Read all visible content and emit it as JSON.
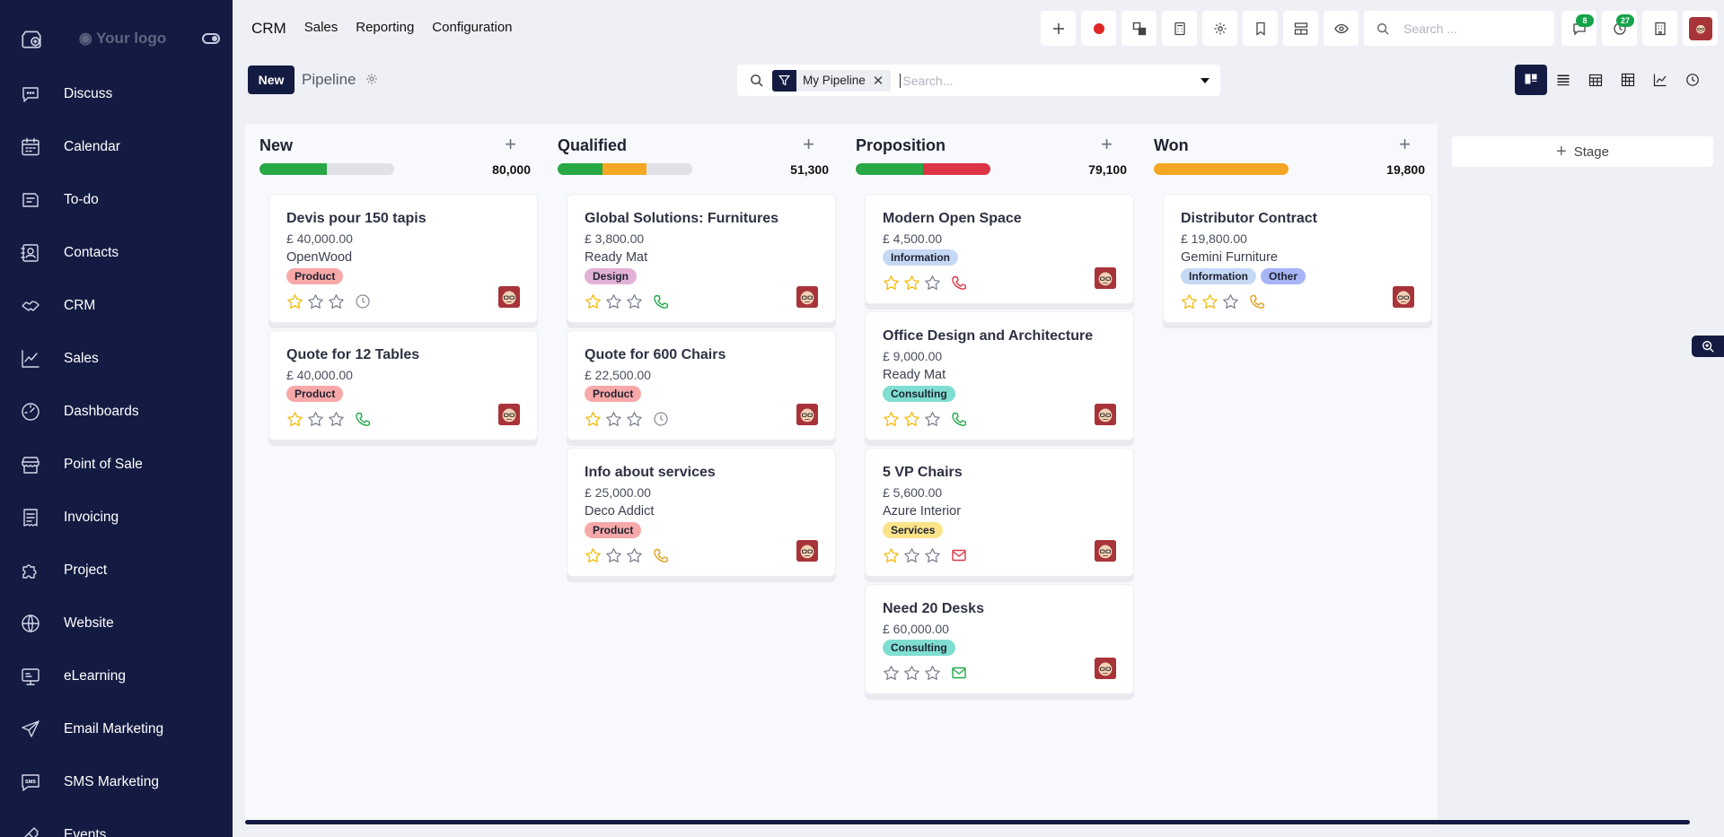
{
  "sidebar": {
    "logo_text": "Your logo",
    "items": [
      {
        "label": "Discuss",
        "icon": "chat-icon"
      },
      {
        "label": "Calendar",
        "icon": "calendar-icon"
      },
      {
        "label": "To-do",
        "icon": "todo-icon"
      },
      {
        "label": "Contacts",
        "icon": "contacts-icon"
      },
      {
        "label": "CRM",
        "icon": "handshake-icon"
      },
      {
        "label": "Sales",
        "icon": "sales-chart-icon"
      },
      {
        "label": "Dashboards",
        "icon": "gauge-icon"
      },
      {
        "label": "Point of Sale",
        "icon": "store-icon"
      },
      {
        "label": "Invoicing",
        "icon": "invoice-icon"
      },
      {
        "label": "Project",
        "icon": "puzzle-icon"
      },
      {
        "label": "Website",
        "icon": "globe-icon"
      },
      {
        "label": "eLearning",
        "icon": "elearning-icon"
      },
      {
        "label": "Email Marketing",
        "icon": "paper-plane-icon"
      },
      {
        "label": "SMS Marketing",
        "icon": "sms-icon"
      },
      {
        "label": "Events",
        "icon": "ticket-icon"
      }
    ]
  },
  "topbar": {
    "brand": "CRM",
    "menu": [
      "Sales",
      "Reporting",
      "Configuration"
    ],
    "search_placeholder": "Search ...",
    "messages_count": "8",
    "activities_count": "27"
  },
  "control": {
    "new_label": "New",
    "breadcrumb": "Pipeline",
    "facet_label": "My Pipeline",
    "search_placeholder": "Search..."
  },
  "add_stage_label": "Stage",
  "colors": {
    "sidebar_bg": "#141b42",
    "green": "#28a745",
    "orange": "#f5a623",
    "red": "#dc3545",
    "grey": "#e0e2e8"
  },
  "tag_colors": {
    "Product": "#f7a8a8",
    "Design": "#e3b1d6",
    "Information": "#c5d9f5",
    "Consulting": "#7fded1",
    "Services": "#fbe389",
    "Other": "#a7b4f5"
  },
  "columns": [
    {
      "name": "New",
      "total": "80,000",
      "progress": [
        {
          "color": "#28a745",
          "pct": 50
        },
        {
          "color": "#e0e2e8",
          "pct": 50
        }
      ],
      "cards": [
        {
          "title": "Devis pour 150 tapis",
          "amount": "£ 40,000.00",
          "company": "OpenWood",
          "tags": [
            "Product"
          ],
          "stars": 1,
          "activity": "clock"
        },
        {
          "title": "Quote for 12 Tables",
          "amount": "£ 40,000.00",
          "company": "",
          "tags": [
            "Product"
          ],
          "stars": 1,
          "activity": "phone-green"
        }
      ]
    },
    {
      "name": "Qualified",
      "total": "51,300",
      "progress": [
        {
          "color": "#28a745",
          "pct": 33
        },
        {
          "color": "#f5a623",
          "pct": 33
        },
        {
          "color": "#e0e2e8",
          "pct": 34
        }
      ],
      "cards": [
        {
          "title": "Global Solutions: Furnitures",
          "amount": "£ 3,800.00",
          "company": "Ready Mat",
          "tags": [
            "Design"
          ],
          "stars": 1,
          "activity": "phone-green"
        },
        {
          "title": "Quote for 600 Chairs",
          "amount": "£ 22,500.00",
          "company": "",
          "tags": [
            "Product"
          ],
          "stars": 1,
          "activity": "clock"
        },
        {
          "title": "Info about services",
          "amount": "£ 25,000.00",
          "company": "Deco Addict",
          "tags": [
            "Product"
          ],
          "stars": 1,
          "activity": "phone-orange"
        }
      ]
    },
    {
      "name": "Proposition",
      "total": "79,100",
      "progress": [
        {
          "color": "#28a745",
          "pct": 50
        },
        {
          "color": "#dc3545",
          "pct": 50
        }
      ],
      "cards": [
        {
          "title": "Modern Open Space",
          "amount": "£ 4,500.00",
          "company": "",
          "tags": [
            "Information"
          ],
          "stars": 2,
          "activity": "phone-red"
        },
        {
          "title": "Office Design and Architecture",
          "amount": "£ 9,000.00",
          "company": "Ready Mat",
          "tags": [
            "Consulting"
          ],
          "stars": 2,
          "activity": "phone-green"
        },
        {
          "title": "5 VP Chairs",
          "amount": "£ 5,600.00",
          "company": "Azure Interior",
          "tags": [
            "Services"
          ],
          "stars": 1,
          "activity": "mail-red"
        },
        {
          "title": "Need 20 Desks",
          "amount": "£ 60,000.00",
          "company": "",
          "tags": [
            "Consulting"
          ],
          "stars": 0,
          "activity": "mail-green"
        }
      ]
    },
    {
      "name": "Won",
      "total": "19,800",
      "progress": [
        {
          "color": "#f5a623",
          "pct": 100
        }
      ],
      "cards": [
        {
          "title": "Distributor Contract",
          "amount": "£ 19,800.00",
          "company": "Gemini Furniture",
          "tags": [
            "Information",
            "Other"
          ],
          "stars": 2,
          "activity": "phone-orange"
        }
      ]
    }
  ]
}
